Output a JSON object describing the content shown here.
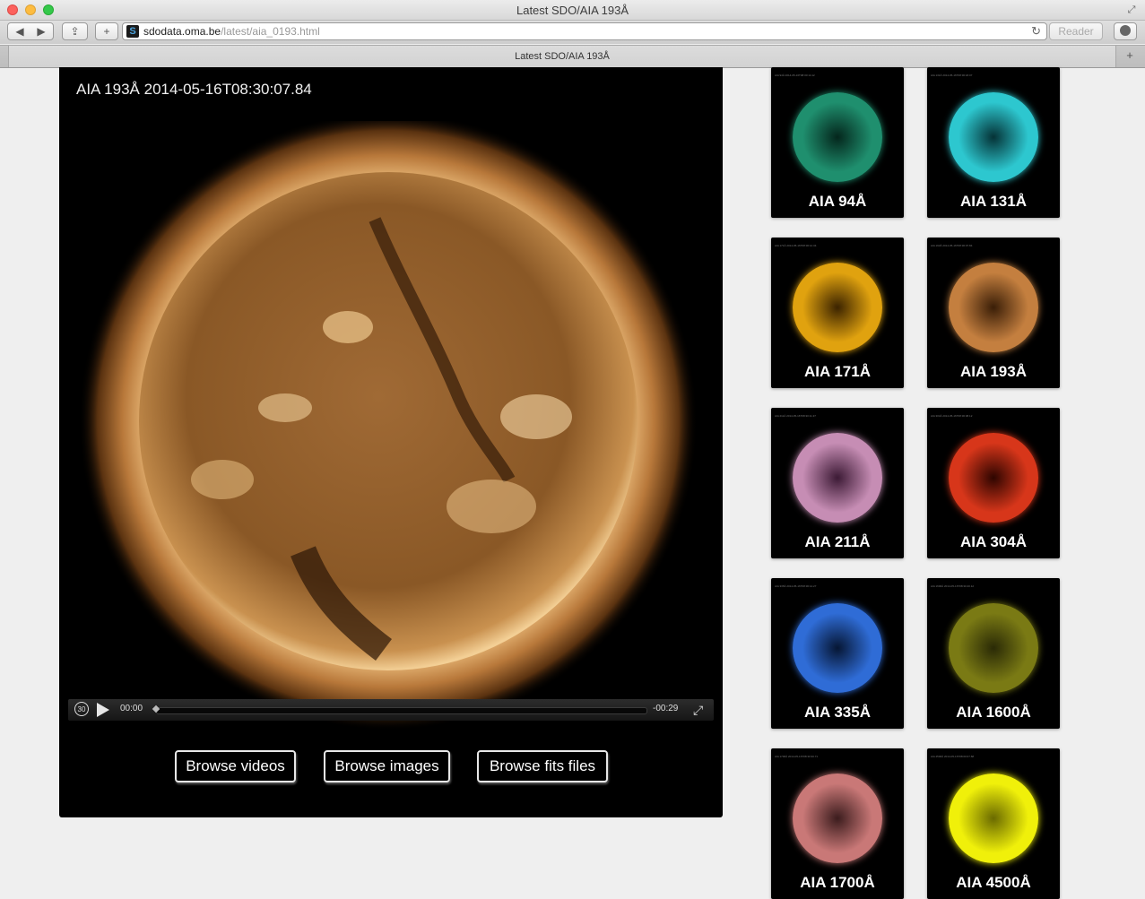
{
  "window": {
    "title": "Latest SDO/AIA 193Å"
  },
  "toolbar": {
    "url_host": "sdodata.oma.be",
    "url_path": "/latest/aia_0193.html",
    "reader_label": "Reader"
  },
  "tab": {
    "title": "Latest SDO/AIA 193Å"
  },
  "player": {
    "title": "AIA 193Å 2014-05-16T08:30:07.84",
    "skip_label": "30",
    "time_current": "00:00",
    "time_remaining": "-00:29",
    "progress": 0
  },
  "browse": {
    "videos": "Browse videos",
    "images": "Browse images",
    "fits": "Browse fits files"
  },
  "thumbnails": [
    {
      "label": "AIA 94Å",
      "caption": "AIA 94Å 2014-05-16T08:30:14.12",
      "color": "#1f8f6e",
      "dark": "#04261c"
    },
    {
      "label": "AIA 131Å",
      "caption": "AIA 131Å 2014-05-16T08:30:18.07",
      "color": "#2dc7cf",
      "dark": "#053236"
    },
    {
      "label": "AIA 171Å",
      "caption": "AIA 171Å 2014-05-16T08:30:12.34",
      "color": "#e0a20f",
      "dark": "#3b2300"
    },
    {
      "label": "AIA 193Å",
      "caption": "AIA 193Å 2014-05-16T08:30:07.84",
      "color": "#c47f3f",
      "dark": "#3a1e07"
    },
    {
      "label": "AIA 211Å",
      "caption": "AIA 211Å 2014-05-16T08:30:11.37",
      "color": "#c68db4",
      "dark": "#3c1a35"
    },
    {
      "label": "AIA 304Å",
      "caption": "AIA 304Å 2014-05-16T08:30:08.12",
      "color": "#d7361a",
      "dark": "#2e0500"
    },
    {
      "label": "AIA 335Å",
      "caption": "AIA 335Å 2014-05-16T08:30:14.27",
      "color": "#2f6cd6",
      "dark": "#061633"
    },
    {
      "label": "AIA 1600Å",
      "caption": "AIA 1600Å 2014-05-16T08:30:40.12",
      "color": "#7a7a14",
      "dark": "#2a2a06"
    },
    {
      "label": "AIA 1700Å",
      "caption": "AIA 1700Å 2014-05-16T08:30:30.71",
      "color": "#c97877",
      "dark": "#3b1c1d"
    },
    {
      "label": "AIA 4500Å",
      "caption": "AIA 4500Å 2014-05-16T08:00:07.68",
      "color": "#f0f00a",
      "dark": "#6a6a00"
    }
  ]
}
